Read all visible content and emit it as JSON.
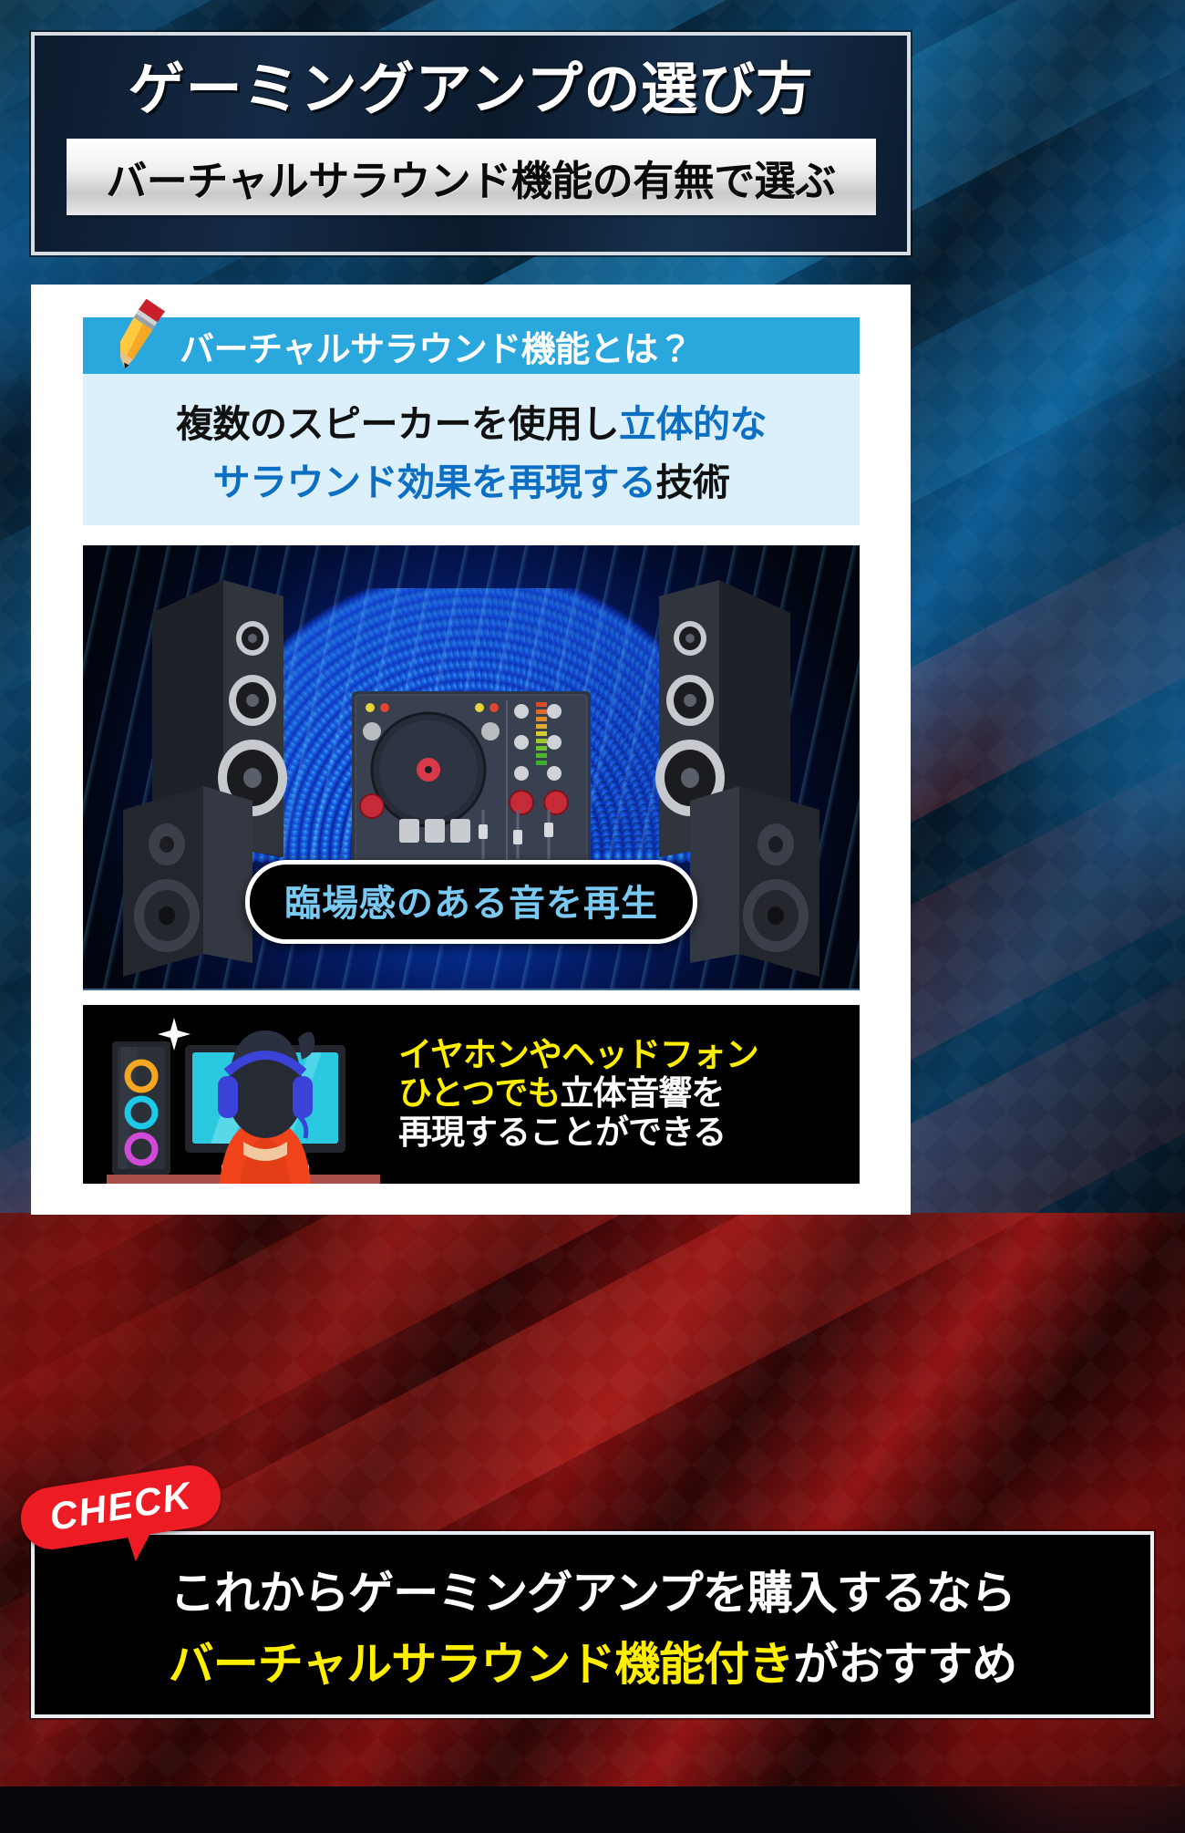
{
  "header": {
    "title": "ゲーミングアンプの選び方",
    "subtitle": "バーチャルサラウンド機能の有無で選ぶ"
  },
  "card": {
    "banner": {
      "icon": "pencil-icon",
      "label": "バーチャルサラウンド機能とは？",
      "bg_color": "#2aa8dd"
    },
    "definition": {
      "line1_dark": "複数のスピーカーを使用し",
      "line1_blue": "立体的な",
      "line2_blue": "サラウンド効果を再現する",
      "line2_dark": "技術",
      "bg_color": "#dcf0fb",
      "blue_color": "#0d6fc4"
    },
    "hero": {
      "caption": "臨場感のある音を再生",
      "caption_color": "#79c9f2"
    },
    "strip": {
      "line1": "イヤホンやヘッドフォン",
      "line2_yellow": "ひとつでも",
      "line2_white": "立体音響を",
      "line3": "再現することができる",
      "yellow_color": "#ffee00",
      "bg_color": "#000000"
    }
  },
  "check_badge": {
    "label": "CHECK",
    "color": "#ed1c24"
  },
  "footer": {
    "line1": "これからゲーミングアンプを購入するなら",
    "line2_yellow": "バーチャルサラウンド機能付き",
    "line2_white": "がおすすめ",
    "yellow_color": "#ffee00",
    "bg_color": "#000000"
  }
}
